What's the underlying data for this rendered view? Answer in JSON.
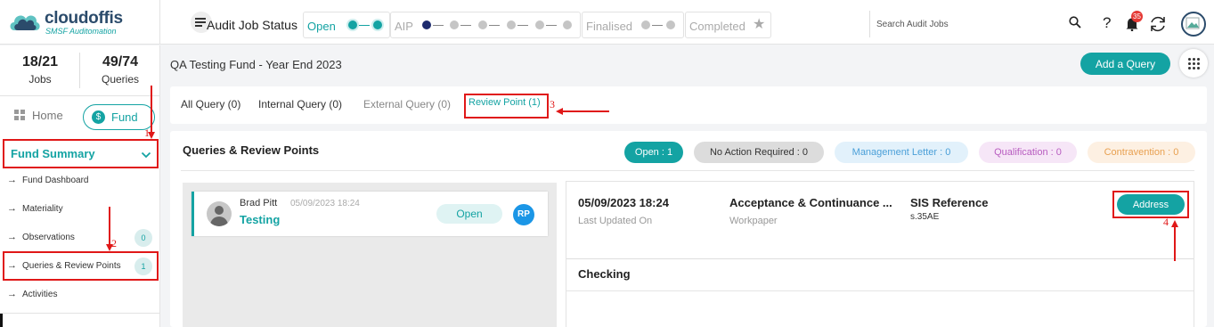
{
  "brand": {
    "name": "cloudoffis",
    "tagline": "SMSF Auditomation"
  },
  "status_bar": {
    "title": "Audit Job Status",
    "stages": [
      {
        "label": "Open",
        "state": "active"
      },
      {
        "label": "AIP",
        "state": "partial"
      },
      {
        "label": "Finalised",
        "state": "pending"
      },
      {
        "label": "Completed",
        "state": "pending"
      }
    ]
  },
  "search": {
    "placeholder": "Search Audit Jobs"
  },
  "notifications": {
    "count": "35"
  },
  "sidebar": {
    "stats": [
      {
        "value": "18/21",
        "label": "Jobs"
      },
      {
        "value": "49/74",
        "label": "Queries"
      }
    ],
    "home_label": "Home",
    "fund_label": "Fund",
    "fund_summary_label": "Fund Summary",
    "items": [
      {
        "label": "Fund Dashboard",
        "badge": ""
      },
      {
        "label": "Materiality",
        "badge": ""
      },
      {
        "label": "Observations",
        "badge": "0"
      },
      {
        "label": "Queries & Review Points",
        "badge": "1"
      },
      {
        "label": "Activities",
        "badge": ""
      }
    ]
  },
  "header": {
    "title": "QA Testing Fund - Year End 2023",
    "add_query_label": "Add a Query"
  },
  "tabs": [
    {
      "label": "All Query (0)"
    },
    {
      "label": "Internal Query (0)"
    },
    {
      "label": "External Query (0)"
    },
    {
      "label": "Review Point (1)"
    }
  ],
  "panel": {
    "title": "Queries & Review Points",
    "chips": [
      {
        "label": "Open : 1",
        "bg": "#14a3a3",
        "fg": "#ffffff"
      },
      {
        "label": "No Action Required : 0",
        "bg": "#dcdcdc",
        "fg": "#333333"
      },
      {
        "label": "Management Letter : 0",
        "bg": "#e2f1fb",
        "fg": "#4a9fd8"
      },
      {
        "label": "Qualification : 0",
        "bg": "#f6e6f7",
        "fg": "#b85cc0"
      },
      {
        "label": "Contravention : 0",
        "bg": "#fdf0e2",
        "fg": "#e8a050"
      }
    ]
  },
  "query": {
    "author": "Brad Pitt",
    "date": "05/09/2023 18:24",
    "subject": "Testing",
    "status": "Open",
    "tag": "RP"
  },
  "detail": {
    "last_updated_value": "05/09/2023 18:24",
    "last_updated_label": "Last Updated On",
    "workpaper_value": "Acceptance & Continuance ...",
    "workpaper_label": "Workpaper",
    "sis_value": "SIS Reference",
    "sis_label": "s.35AE",
    "address_label": "Address",
    "body_title": "Checking"
  },
  "annotations": [
    "1",
    "2",
    "3",
    "4"
  ],
  "colors": {
    "accent": "#14a3a3",
    "highlight": "#e01818"
  }
}
